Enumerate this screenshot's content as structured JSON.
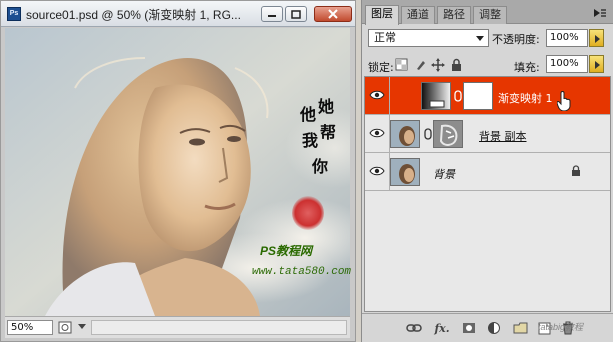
{
  "document_window": {
    "app_icon": "Ps",
    "title": "source01.psd @ 50% (渐变映射 1, RG...",
    "zoom": "50%",
    "buttons": {
      "minimize": "minimize-icon",
      "maximize": "maximize-icon",
      "close": "close-icon"
    }
  },
  "artwork": {
    "calligraphy": [
      "他",
      "她",
      "我",
      "帮",
      "你"
    ],
    "watermark_line1": "PS教程网",
    "watermark_line2": "www.tata580.com"
  },
  "layers_panel": {
    "tabs": [
      "图层",
      "通道",
      "路径",
      "调整"
    ],
    "blend_mode": "正常",
    "opacity_label": "不透明度:",
    "opacity_value": "100%",
    "lock_label": "锁定:",
    "fill_label": "填充:",
    "fill_value": "100%",
    "layers": [
      {
        "name": "渐变映射 1",
        "selected": true,
        "visible": true
      },
      {
        "name": "背景 副本",
        "selected": false,
        "visible": true
      },
      {
        "name": "背景",
        "selected": false,
        "visible": true,
        "locked": true
      }
    ],
    "bottom_icons": [
      "link-icon",
      "fx-icon",
      "mask-icon",
      "adjustment-icon",
      "folder-icon",
      "new-layer-icon",
      "trash-icon"
    ],
    "fx_text": "fx."
  },
  "corner_watermark": "tatabig教程",
  "colors": {
    "selected_layer": "#e63600",
    "panel_bg": "#d6d6d6",
    "slider_button": "#e0ae21"
  }
}
